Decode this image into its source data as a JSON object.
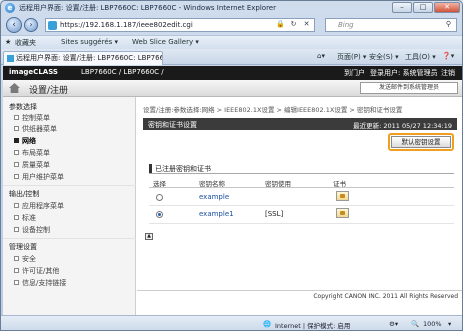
{
  "window": {
    "title": "远程用户界面: 设置/注册: LBP7660C: LBP7660C - Windows Internet Explorer",
    "minimize": "–",
    "maximize": "□",
    "close": "✕"
  },
  "browser": {
    "address": "https://192.168.1.187/ieee802edit.cgi",
    "search_placeholder": "Bing",
    "favorites_label": "收藏夹",
    "fav_links": [
      "Sites suggérés ▾",
      "Web Slice Gallery ▾"
    ],
    "tab_title": "远程用户界面: 设置/注册: LBP7660C: LBP7660C",
    "commands": [
      "页面(P) ▾",
      "安全(S) ▾",
      "工具(O) ▾",
      "❓▾"
    ]
  },
  "app": {
    "brand": "imageCLASS",
    "model": "LBP7660C / LBP7660C /",
    "portal": "到门户",
    "login_user": "登录用户: 系统管理员",
    "logout": "注销",
    "page_title": "设置/注册",
    "send_link": "发送邮件到系统管理员"
  },
  "sidebar": {
    "sections": [
      {
        "title": "参数选择",
        "items": [
          "控制菜单",
          "供纸器菜单",
          "网络",
          "布局菜单",
          "质量菜单",
          "用户维护菜单"
        ]
      },
      {
        "title": "输出/控制",
        "items": [
          "应用程序菜单",
          "标准",
          "设备控制"
        ]
      },
      {
        "title": "管理设置",
        "items": [
          "安全",
          "许可证/其他",
          "信息/支持链接"
        ]
      }
    ],
    "active_item": "网络"
  },
  "main": {
    "breadcrumb": "设置/注册:参数选择:网络 > IEEE802.1X设置 > 编辑IEEE802.1X设置 > 密钥和证书设置",
    "header_title": "密钥和证书设置",
    "last_update": "最近更新: 2011 05/27 12:34:19",
    "register_button": "默认密钥设置",
    "section_title": "已注册密钥和证书",
    "columns": [
      "选择",
      "密钥名称",
      "密钥使用",
      "证书"
    ],
    "rows": [
      {
        "selected": false,
        "name": "example",
        "usage": ""
      },
      {
        "selected": true,
        "name": "example1",
        "usage": "[SSL]"
      }
    ],
    "copyright": "Copyright CANON INC. 2011 All Rights Reserved"
  },
  "statusbar": {
    "zone": "Internet | 保护模式: 启用",
    "zoom": "100%"
  }
}
